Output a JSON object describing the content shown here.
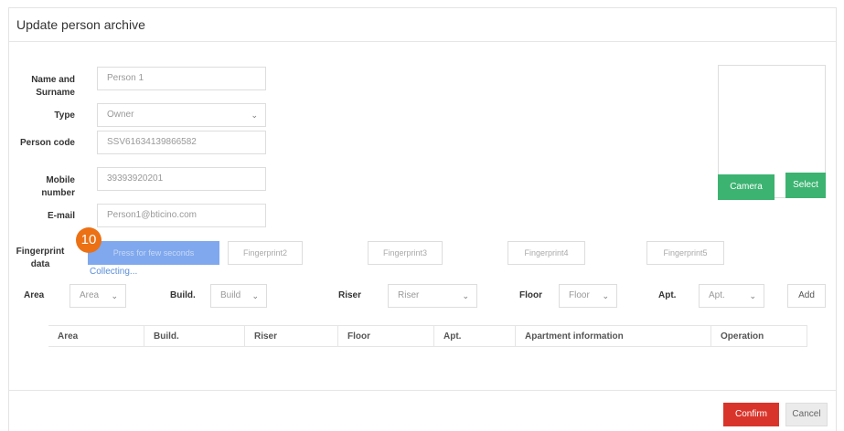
{
  "dialog": {
    "title": "Update person archive"
  },
  "form": {
    "name_label": "Name and Surname",
    "name_value": "Person 1",
    "type_label": "Type",
    "type_value": "Owner",
    "code_label": "Person code",
    "code_value": "SSV61634139866582",
    "mobile_label": "Mobile number",
    "mobile_value": "39393920201",
    "email_label": "E-mail",
    "email_value": "Person1@bticino.com"
  },
  "photo": {
    "camera_label": "Camera",
    "select_label": "Select"
  },
  "fingerprint": {
    "label": "Fingerprint data",
    "badge": "10",
    "items": [
      "Press for few seconds",
      "Fingerprint2",
      "Fingerprint3",
      "Fingerprint4",
      "Fingerprint5"
    ],
    "status": "Collecting..."
  },
  "location": {
    "area_label": "Area",
    "area_value": "Area",
    "build_label": "Build.",
    "build_value": "Build",
    "riser_label": "Riser",
    "riser_value": "Riser",
    "floor_label": "Floor",
    "floor_value": "Floor",
    "apt_label": "Apt.",
    "apt_value": "Apt.",
    "add_label": "Add"
  },
  "table": {
    "columns": [
      "Area",
      "Build.",
      "Riser",
      "Floor",
      "Apt.",
      "Apartment information",
      "Operation"
    ]
  },
  "footer": {
    "confirm_label": "Confirm",
    "cancel_label": "Cancel"
  },
  "colors": {
    "confirm": "#d9342b",
    "camera_select": "#3cb371",
    "active_fingerprint": "#7fa8ee",
    "badge": "#ec7014"
  }
}
